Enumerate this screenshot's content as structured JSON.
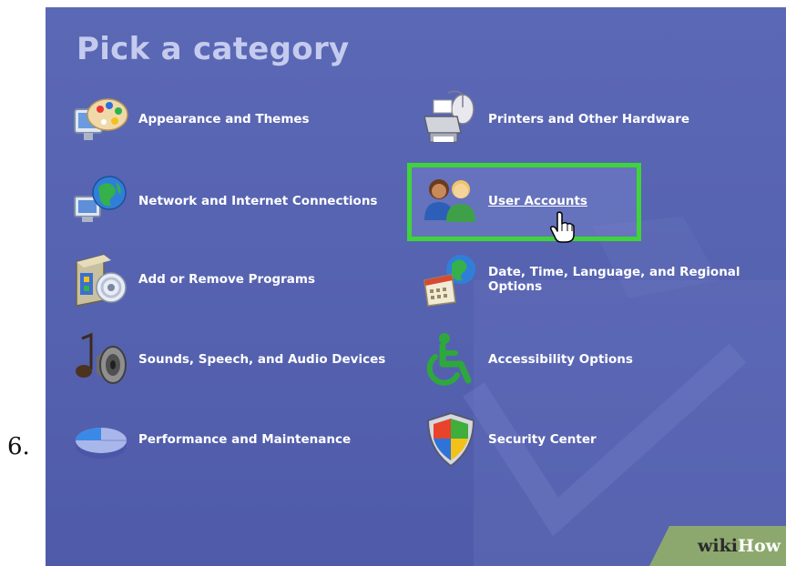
{
  "step_number": "6.",
  "panel": {
    "title": "Pick a category",
    "categories_left": [
      {
        "label": "Appearance and Themes",
        "icon": "palette-monitor-icon"
      },
      {
        "label": "Network and Internet Connections",
        "icon": "globe-network-icon"
      },
      {
        "label": "Add or Remove Programs",
        "icon": "cd-box-icon"
      },
      {
        "label": "Sounds, Speech, and Audio Devices",
        "icon": "speaker-note-icon"
      },
      {
        "label": "Performance and Maintenance",
        "icon": "pie-chart-icon"
      }
    ],
    "categories_right": [
      {
        "label": "Printers and Other Hardware",
        "icon": "printer-mouse-icon"
      },
      {
        "label": "User Accounts",
        "icon": "users-icon",
        "highlighted": true
      },
      {
        "label": "Date, Time, Language, and Regional Options",
        "icon": "calendar-globe-icon"
      },
      {
        "label": "Accessibility Options",
        "icon": "wheelchair-icon"
      },
      {
        "label": "Security Center",
        "icon": "windows-shield-icon"
      }
    ]
  },
  "watermark": {
    "part1": "wiki",
    "part2": "How"
  },
  "colors": {
    "panel_bg": "#5562b0",
    "title": "#c4cbee",
    "highlight_border": "#3fd43a",
    "label": "#ffffff"
  }
}
